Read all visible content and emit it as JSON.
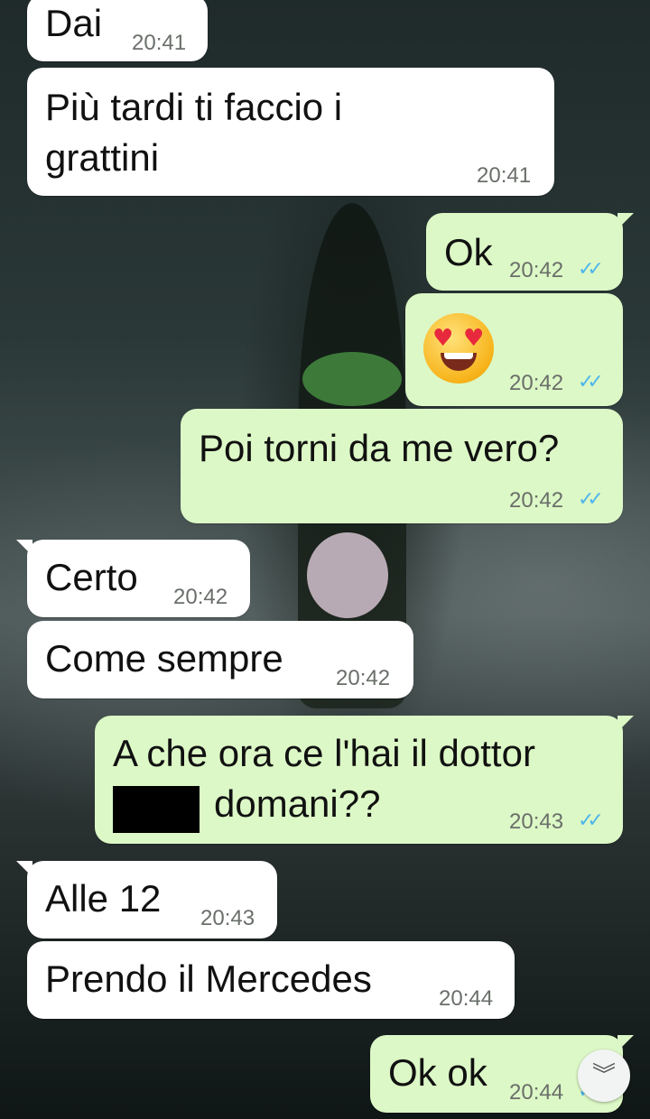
{
  "messages": [
    {
      "id": "m1",
      "direction": "in",
      "lines": [
        "Dai"
      ],
      "time": "20:41"
    },
    {
      "id": "m2",
      "direction": "in",
      "lines": [
        "Più tardi ti faccio i",
        "grattini"
      ],
      "time": "20:41"
    },
    {
      "id": "m3",
      "direction": "out",
      "lines": [
        "Ok"
      ],
      "time": "20:42",
      "status": "read"
    },
    {
      "id": "m4",
      "direction": "out",
      "emoji": "heart-eyes-face",
      "time": "20:42",
      "status": "read"
    },
    {
      "id": "m5",
      "direction": "out",
      "lines": [
        "Poi torni da me vero?"
      ],
      "time": "20:42",
      "status": "read"
    },
    {
      "id": "m6",
      "direction": "in",
      "lines": [
        "Certo"
      ],
      "time": "20:42"
    },
    {
      "id": "m7",
      "direction": "in",
      "lines": [
        "Come sempre"
      ],
      "time": "20:42"
    },
    {
      "id": "m8",
      "direction": "out",
      "lines": [
        "A che ora ce l'hai il dottor",
        "domani??"
      ],
      "time": "20:43",
      "status": "read",
      "redacted": true
    },
    {
      "id": "m9",
      "direction": "in",
      "lines": [
        "Alle 12"
      ],
      "time": "20:43"
    },
    {
      "id": "m10",
      "direction": "in",
      "lines": [
        "Prendo il Mercedes"
      ],
      "time": "20:44"
    },
    {
      "id": "m11",
      "direction": "out",
      "lines": [
        "Ok ok"
      ],
      "time": "20:44",
      "status": "read"
    }
  ],
  "ticks_glyph": "✓✓",
  "scroll_button": {
    "icon": "chevron-double-down-icon",
    "glyph": "︾"
  },
  "colors": {
    "incoming": "#ffffff",
    "outgoing": "#dcf8c6",
    "read_ticks": "#4fb6ec"
  }
}
